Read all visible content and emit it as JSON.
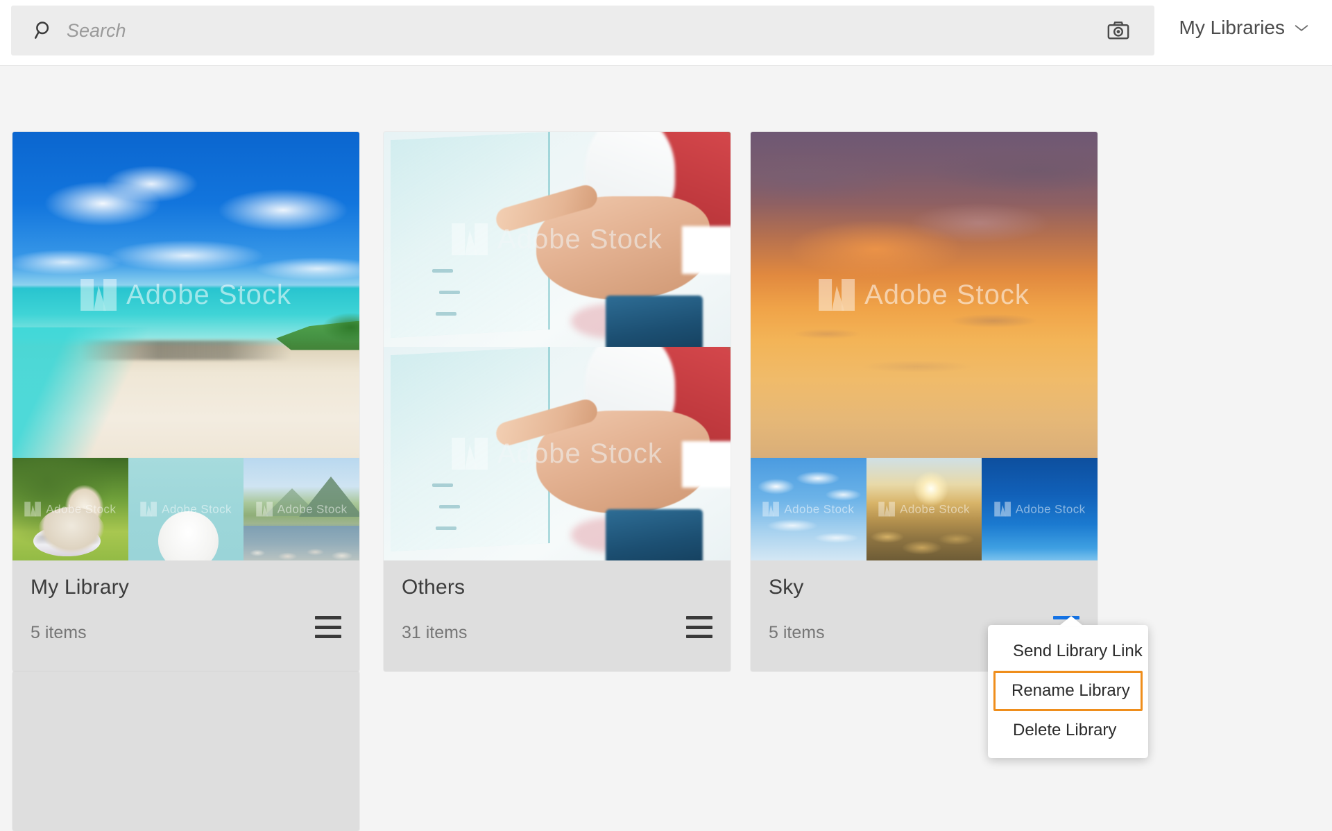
{
  "header": {
    "search": {
      "placeholder": "Search",
      "value": "",
      "icon": "search-icon"
    },
    "camera_icon": "camera-icon",
    "libraries_dropdown": {
      "label": "My Libraries",
      "chevron_icon": "chevron-down-icon"
    }
  },
  "watermark": {
    "text": "Adobe Stock"
  },
  "colors": {
    "accent_blue": "#1473e6",
    "highlight_orange": "#ef8e1c",
    "page_bg": "#f4f4f4",
    "card_bg": "#dedede",
    "topbar_bg": "#ffffff",
    "search_bg": "#ececec"
  },
  "libraries": [
    {
      "name": "My Library",
      "item_count": "5 items",
      "menu_icon": "hamburger-menu-icon",
      "menu_active": false,
      "hero": {
        "art": "art-beach",
        "watermark": true
      },
      "thumbnails": [
        {
          "art": "art-dog1",
          "watermark": true
        },
        {
          "art": "art-dog2",
          "watermark": true
        },
        {
          "art": "art-mtn",
          "watermark": true
        }
      ]
    },
    {
      "name": "Others",
      "item_count": "31 items",
      "menu_icon": "hamburger-menu-icon",
      "menu_active": false,
      "hero": {
        "art": "art-glass",
        "watermark": true
      },
      "thumbnails": [],
      "second_hero": {
        "art": "art-glass",
        "watermark": true
      }
    },
    {
      "name": "Sky",
      "item_count": "5 items",
      "menu_icon": "hamburger-menu-icon",
      "menu_active": true,
      "hero": {
        "art": "art-sunset",
        "watermark": true
      },
      "thumbnails": [
        {
          "art": "art-bluesky",
          "watermark": true
        },
        {
          "art": "art-sunrise",
          "watermark": true
        },
        {
          "art": "art-deepblue",
          "watermark": true
        }
      ]
    }
  ],
  "context_menu": {
    "visible": true,
    "items": [
      {
        "label": "Send Library Link",
        "selected": false
      },
      {
        "label": "Rename Library",
        "selected": true
      },
      {
        "label": "Delete Library",
        "selected": false
      }
    ]
  }
}
